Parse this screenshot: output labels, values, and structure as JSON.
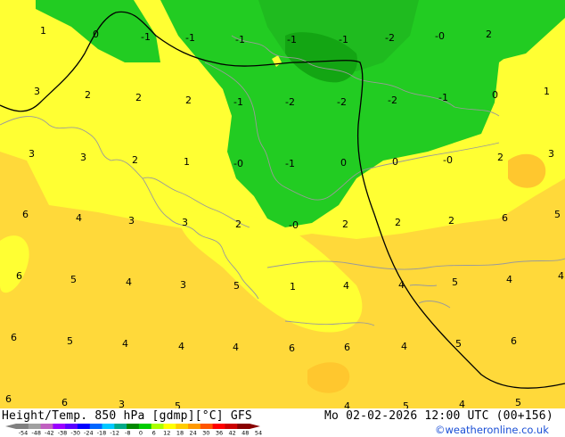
{
  "map": {
    "isotherm_values": [
      "1",
      "0",
      "-1",
      "-1",
      "-1",
      "-1",
      "-1",
      "-2",
      "-0",
      "2",
      "3",
      "2",
      "2",
      "2",
      "-1",
      "-2",
      "-2",
      "-2",
      "-1",
      "0",
      "1",
      "3",
      "3",
      "2",
      "1",
      "-0",
      "-1",
      "0",
      "0",
      "-0",
      "2",
      "3",
      "6",
      "4",
      "3",
      "3",
      "2",
      "-0",
      "2",
      "2",
      "2",
      "6",
      "5",
      "6",
      "5",
      "4",
      "3",
      "5",
      "1",
      "4",
      "4",
      "5",
      "4",
      "4",
      "6",
      "5",
      "4",
      "4",
      "4",
      "6",
      "6",
      "4",
      "5",
      "6",
      "6",
      "6",
      "3",
      "5",
      "4",
      "5",
      "4",
      "5"
    ],
    "colors": {
      "warm_yellow": "#ffff33",
      "orange_yellow": "#ffd93a",
      "green_light": "#22cc22",
      "green_mid": "#1fbb1f",
      "green_dark": "#13a513",
      "contour_line": "#000000",
      "coastline": "#9a9a9a"
    }
  },
  "footer": {
    "title": "Height/Temp. 850 hPa [gdmp][°C] GFS",
    "datetime": "Mo 02-02-2026 12:00 UTC (00+156)",
    "credit": "©weatheronline.co.uk",
    "colorbar": {
      "labels": [
        "-54",
        "-48",
        "-42",
        "-38",
        "-30",
        "-24",
        "-18",
        "-12",
        "-8",
        "0",
        "6",
        "12",
        "18",
        "24",
        "30",
        "36",
        "42",
        "48",
        "54"
      ],
      "colors": [
        "#808080",
        "#a0a0a0",
        "#c060c0",
        "#9a00ff",
        "#5a00ff",
        "#0000ff",
        "#0066ff",
        "#00c8ff",
        "#00aa88",
        "#008800",
        "#00cc00",
        "#aaff00",
        "#ffff00",
        "#ffcc00",
        "#ff9900",
        "#ff5500",
        "#ff0000",
        "#cc0000",
        "#880000"
      ]
    }
  }
}
